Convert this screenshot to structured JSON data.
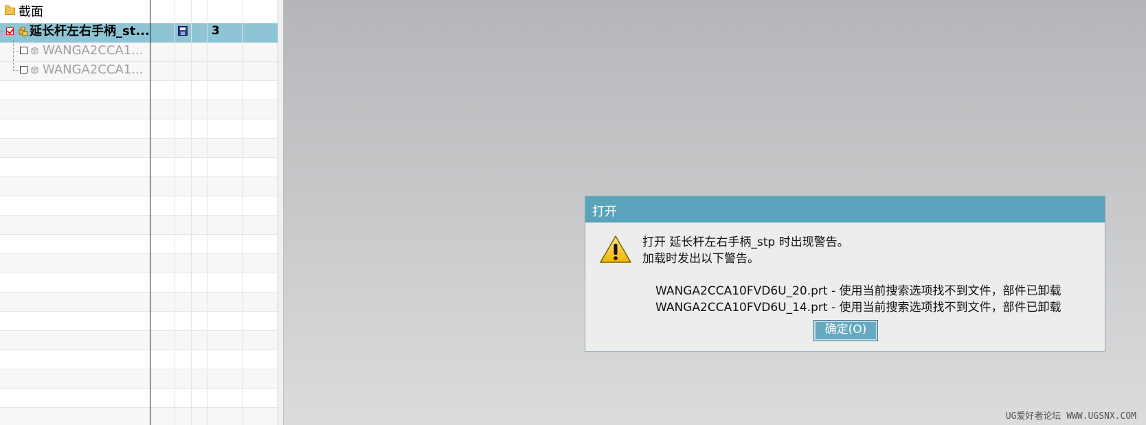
{
  "tree": {
    "section_label": "截面",
    "root_item": {
      "label": "延长杆左右手柄_st...",
      "count": "3",
      "checked": true
    },
    "children": [
      {
        "label": "WANGA2CCA1..."
      },
      {
        "label": "WANGA2CCA1..."
      }
    ]
  },
  "dialog": {
    "title": "打开",
    "message_line1": "打开 延长杆左右手柄_stp 时出现警告。",
    "message_line2": "加载时发出以下警告。",
    "warnings": [
      "WANGA2CCA10FVD6U_20.prt - 使用当前搜索选项找不到文件，部件已卸载",
      "WANGA2CCA10FVD6U_14.prt - 使用当前搜索选项找不到文件，部件已卸载"
    ],
    "ok_label": "确定(O)",
    "icon": "warning-icon"
  },
  "watermark": "UG爱好者论坛 WWW.UGSNX.COM",
  "colors": {
    "selection": "#8ec4d4",
    "dialog_titlebar": "#5aa3bb",
    "ok_button": "#66a9c1"
  }
}
